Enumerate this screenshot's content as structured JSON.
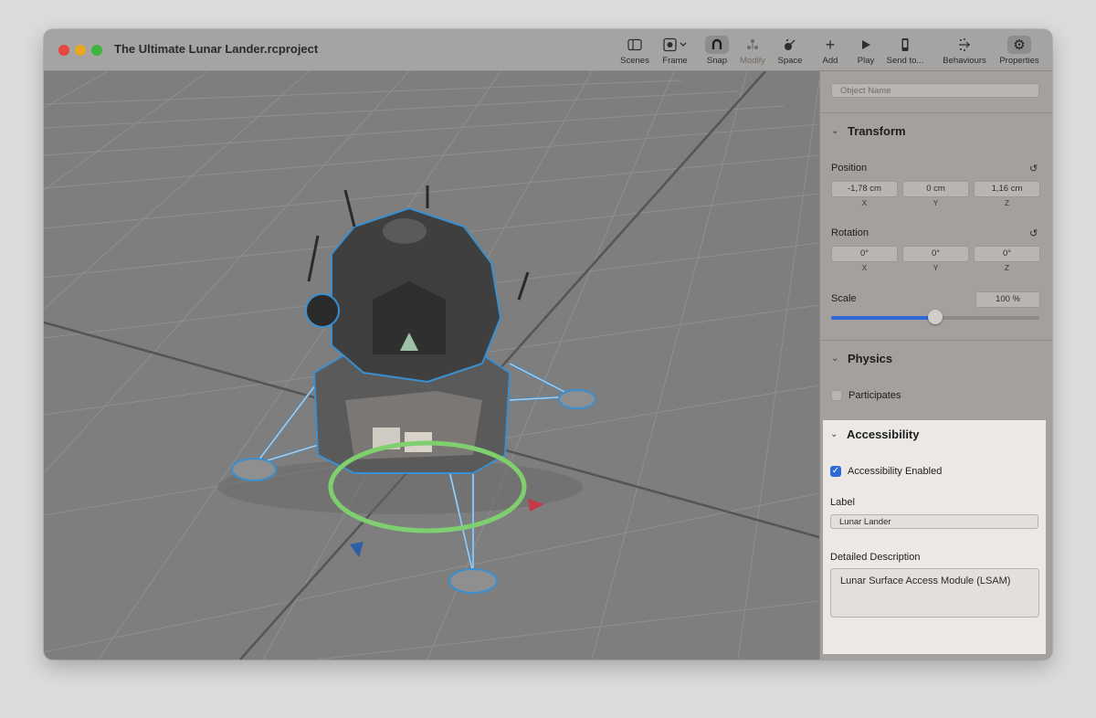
{
  "window": {
    "title": "The Ultimate Lunar Lander.rcproject"
  },
  "toolbar": {
    "items": [
      {
        "label": "Scenes",
        "icon": "sidebar-icon"
      },
      {
        "label": "Frame",
        "icon": "frame-icon"
      },
      {
        "label": "Snap",
        "icon": "magnet-icon",
        "active": true
      },
      {
        "label": "Modify",
        "icon": "modify-icon",
        "disabled": true
      },
      {
        "label": "Space",
        "icon": "space-icon"
      },
      {
        "label": "Add",
        "icon": "plus-icon"
      },
      {
        "label": "Play",
        "icon": "play-icon"
      },
      {
        "label": "Send to...",
        "icon": "device-icon"
      },
      {
        "label": "Behaviours",
        "icon": "behaviours-icon"
      },
      {
        "label": "Properties",
        "icon": "gear-icon",
        "active": true
      }
    ]
  },
  "inspector": {
    "object_name_placeholder": "Object Name",
    "transform": {
      "title": "Transform",
      "position": {
        "label": "Position",
        "x": "-1,78 cm",
        "y": "0 cm",
        "z": "1,16 cm"
      },
      "rotation": {
        "label": "Rotation",
        "x": "0°",
        "y": "0°",
        "z": "0°"
      },
      "axes": {
        "x": "X",
        "y": "Y",
        "z": "Z"
      },
      "scale": {
        "label": "Scale",
        "value": "100 %",
        "slider_fraction": 0.5
      }
    },
    "physics": {
      "title": "Physics",
      "participates_label": "Participates",
      "participates": false
    },
    "accessibility": {
      "title": "Accessibility",
      "enabled_label": "Accessibility Enabled",
      "enabled": true,
      "label_title": "Label",
      "label_value": "Lunar Lander",
      "description_title": "Detailed Description",
      "description_value": "Lunar Surface Access Module (LSAM)"
    }
  },
  "colors": {
    "accent": "#2e68d9",
    "selection_outline": "#3a8fd0",
    "gizmo_ring": "#7fcf6f"
  }
}
